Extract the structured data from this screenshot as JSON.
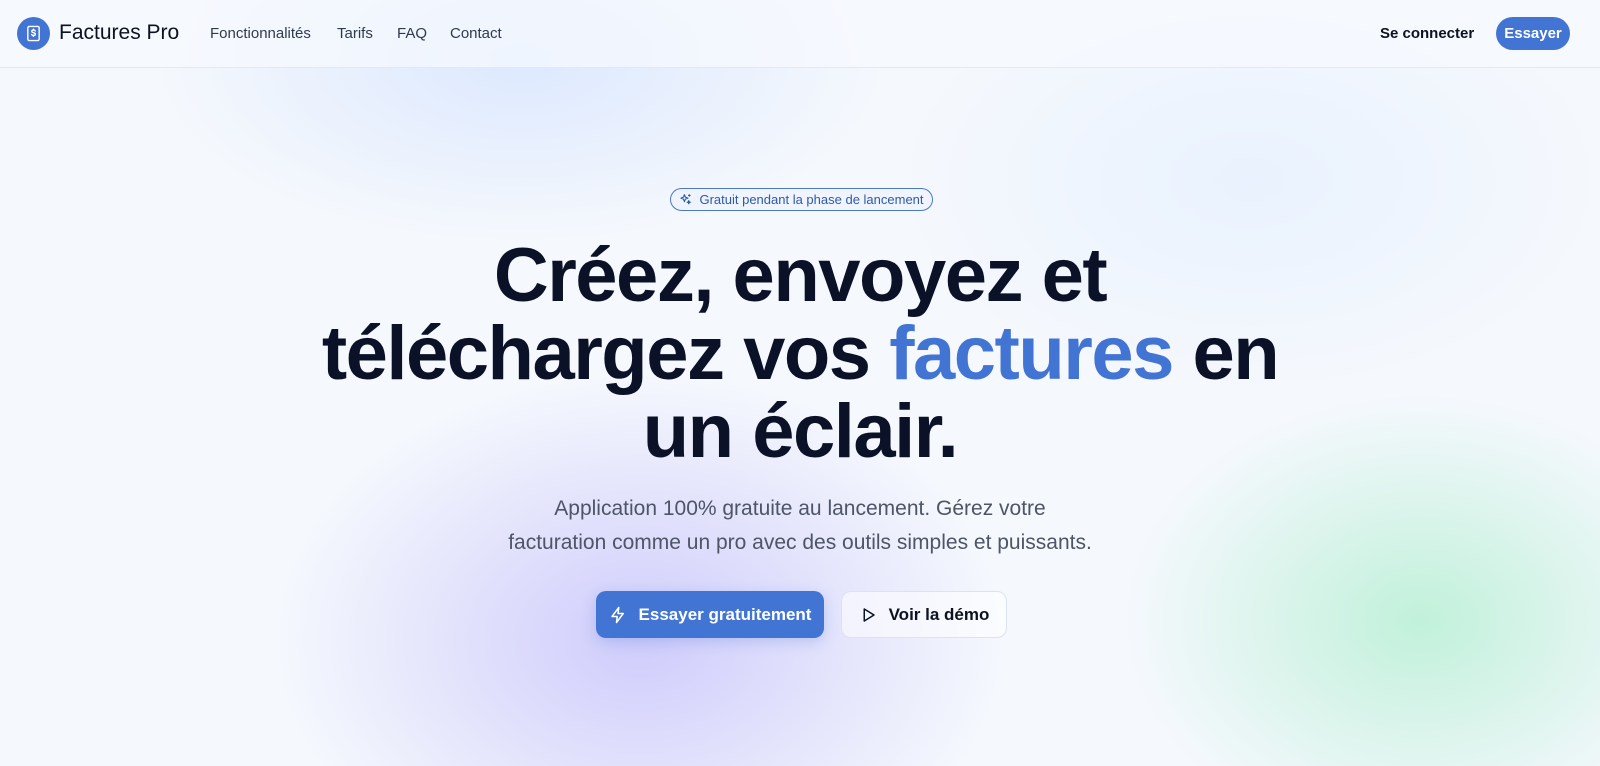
{
  "brand": {
    "name": "Factures Pro",
    "logo_icon": "dollar-receipt-icon",
    "accent_color": "#4274d3"
  },
  "nav": {
    "links": [
      "Fonctionnalités",
      "Tarifs",
      "FAQ",
      "Contact"
    ],
    "signin_label": "Se connecter",
    "try_label": "Essayer"
  },
  "hero": {
    "badge": {
      "icon": "sparkles-icon",
      "label": "Gratuit pendant la phase de lancement"
    },
    "title": {
      "line1": "Créez, envoyez et",
      "line2_before": "téléchargez vos ",
      "line2_accent": "factures",
      "line2_after": " en",
      "line3": "un éclair."
    },
    "subtitle": {
      "line1": "Application 100% gratuite au lancement. Gérez votre",
      "line2": "facturation comme un pro avec des outils simples et puissants."
    },
    "cta_primary": {
      "icon": "lightning-icon",
      "label": "Essayer gratuitement"
    },
    "cta_secondary": {
      "icon": "play-icon",
      "label": "Voir la démo"
    }
  }
}
